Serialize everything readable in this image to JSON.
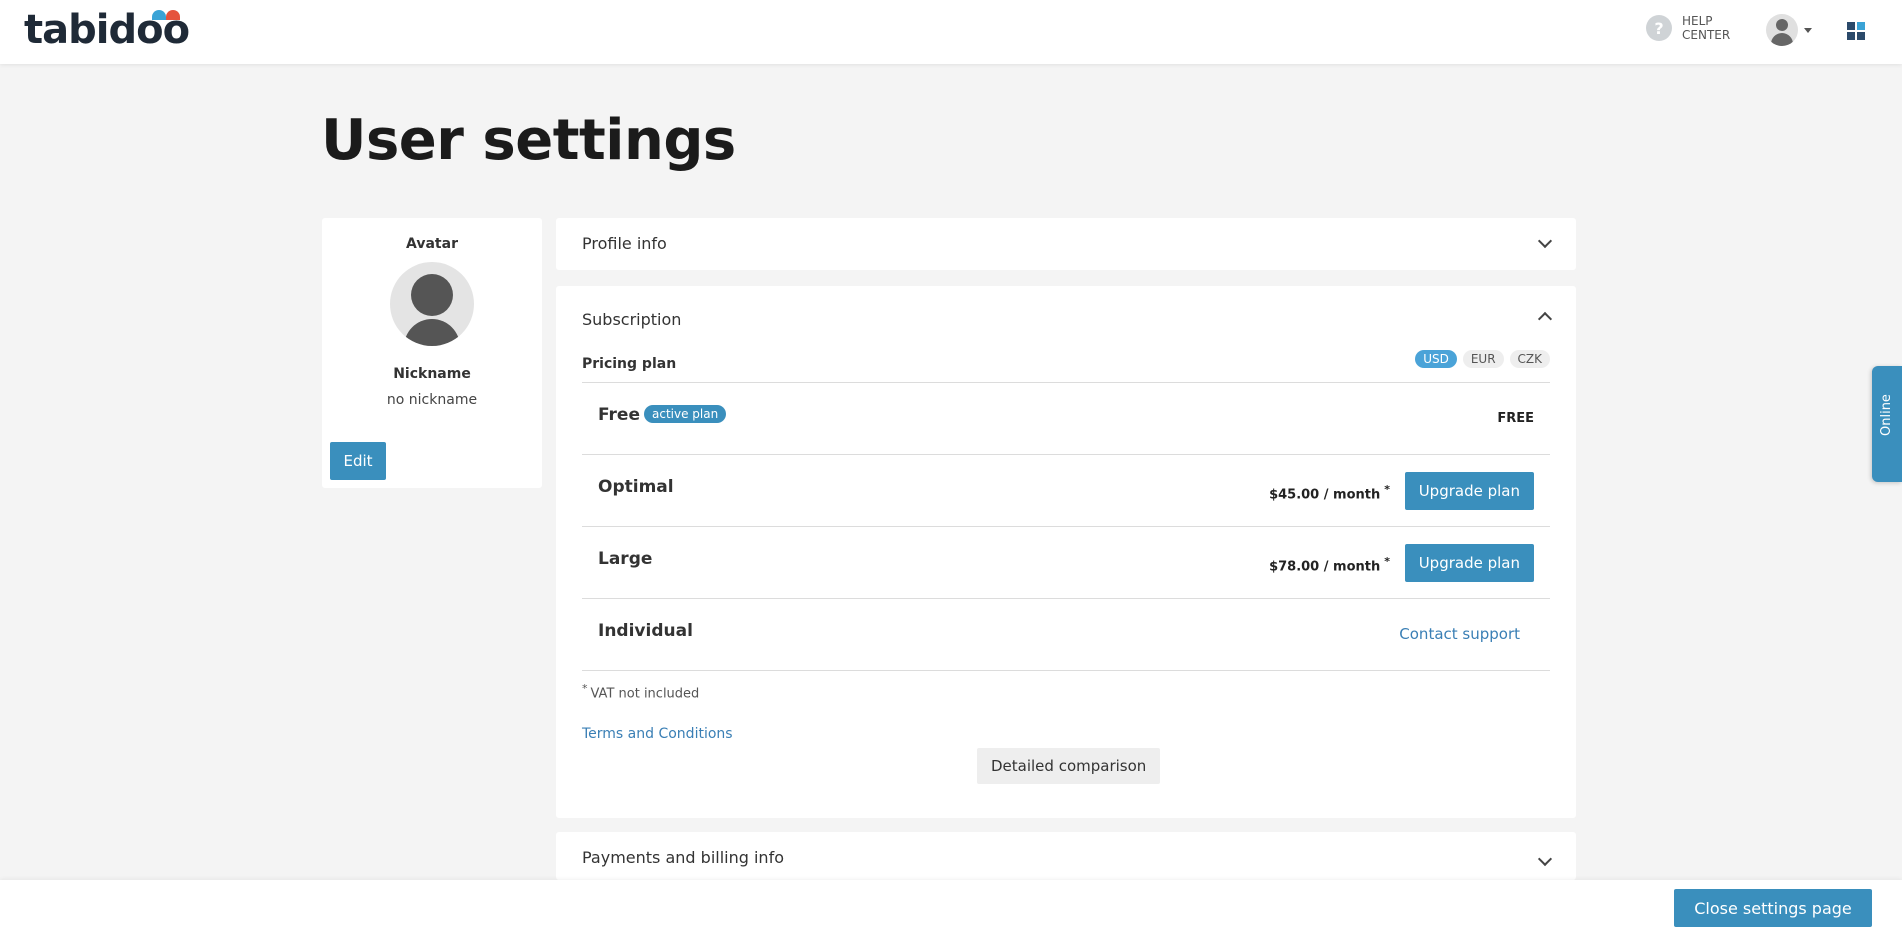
{
  "header": {
    "logo_text": "tabidoo",
    "help_label": "HELP CENTER"
  },
  "page_title": "User settings",
  "avatar_card": {
    "avatar_label": "Avatar",
    "nickname_label": "Nickname",
    "nickname_value": "no nickname",
    "edit_label": "Edit"
  },
  "sections": {
    "profile_title": "Profile info",
    "subscription_title": "Subscription",
    "payments_title": "Payments and billing info"
  },
  "subscription": {
    "pricing_label": "Pricing plan",
    "currencies": [
      "USD",
      "EUR",
      "CZK"
    ],
    "active_currency": "USD",
    "active_badge": "active plan",
    "plans": [
      {
        "name": "Free",
        "price": "FREE"
      },
      {
        "name": "Optimal",
        "price": "$45.00 / month",
        "action": "Upgrade plan"
      },
      {
        "name": "Large",
        "price": "$78.00 / month",
        "action": "Upgrade plan"
      },
      {
        "name": "Individual",
        "action": "Contact support"
      }
    ],
    "price_mark": "*",
    "vat_note": "VAT not included",
    "terms_link": "Terms and Conditions",
    "compare_label": "Detailed comparison"
  },
  "footer": {
    "close_label": "Close settings page"
  },
  "online_tab": "Online",
  "colors": {
    "accent": "#3a8fbd",
    "link": "#3a7fb5",
    "background": "#f4f4f4"
  }
}
